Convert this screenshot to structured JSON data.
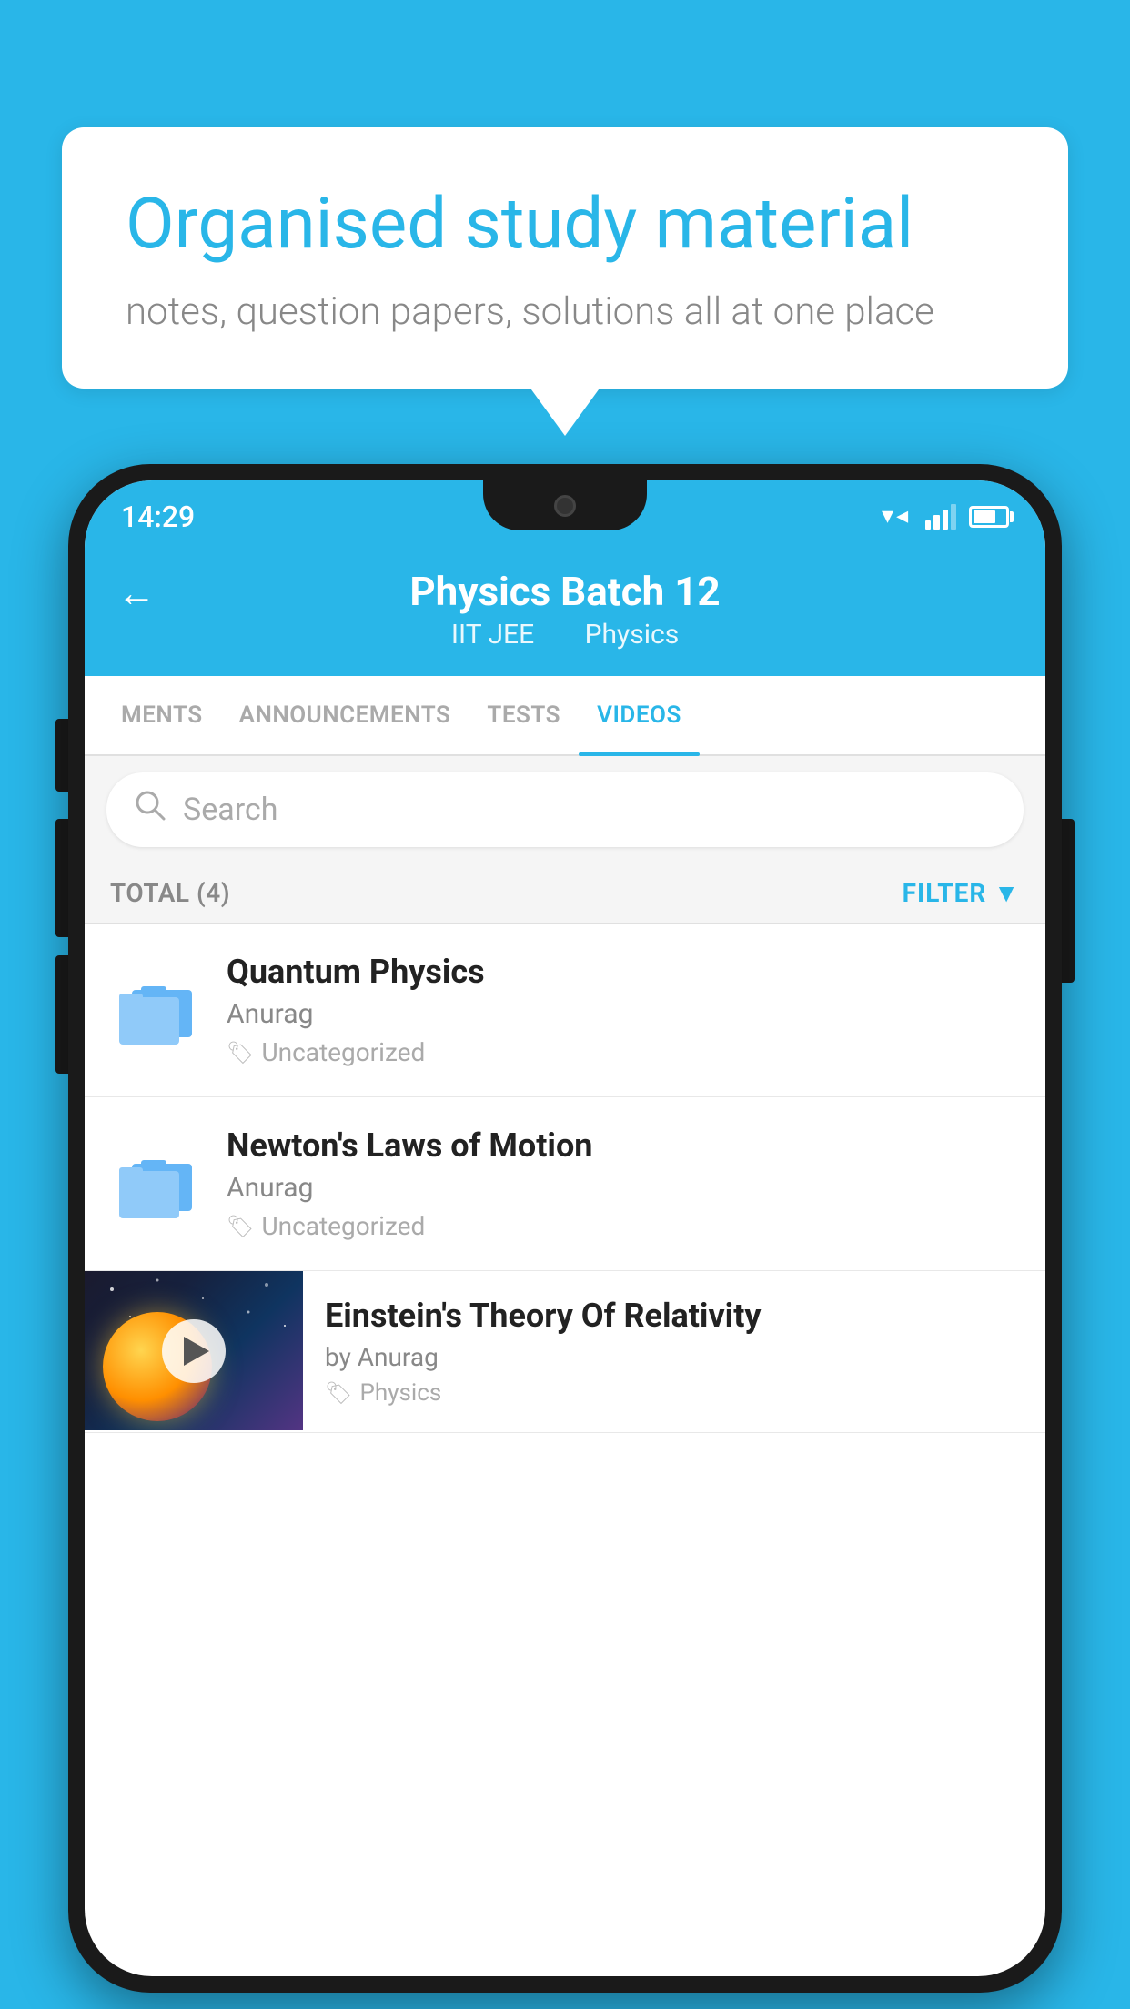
{
  "background_color": "#29b6e8",
  "speech_bubble": {
    "title": "Organised study material",
    "subtitle": "notes, question papers, solutions all at one place"
  },
  "status_bar": {
    "time": "14:29",
    "wifi": "▼",
    "battery_level": "70"
  },
  "header": {
    "title": "Physics Batch 12",
    "subtitle_left": "IIT JEE",
    "subtitle_right": "Physics",
    "back_arrow": "←"
  },
  "tabs": [
    {
      "label": "MENTS",
      "active": false
    },
    {
      "label": "ANNOUNCEMENTS",
      "active": false
    },
    {
      "label": "TESTS",
      "active": false
    },
    {
      "label": "VIDEOS",
      "active": true
    }
  ],
  "search": {
    "placeholder": "Search"
  },
  "filter": {
    "total_label": "TOTAL (4)",
    "filter_label": "FILTER"
  },
  "videos": [
    {
      "id": 1,
      "title": "Quantum Physics",
      "author": "Anurag",
      "tag": "Uncategorized",
      "has_thumbnail": false
    },
    {
      "id": 2,
      "title": "Newton's Laws of Motion",
      "author": "Anurag",
      "tag": "Uncategorized",
      "has_thumbnail": false
    },
    {
      "id": 3,
      "title": "Einstein's Theory Of Relativity",
      "author": "by Anurag",
      "tag": "Physics",
      "has_thumbnail": true
    }
  ]
}
